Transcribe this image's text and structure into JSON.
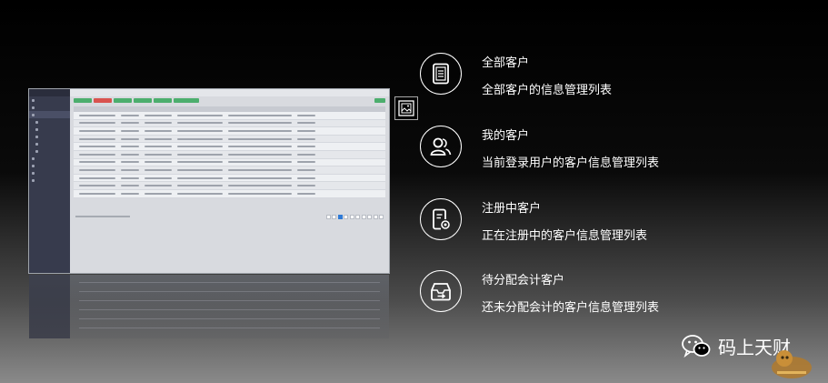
{
  "features": [
    {
      "title": "全部客户",
      "desc": "全部客户的信息管理列表",
      "icon": "document-list-icon"
    },
    {
      "title": "我的客户",
      "desc": "当前登录用户的客户信息管理列表",
      "icon": "users-icon"
    },
    {
      "title": "注册中客户",
      "desc": "正在注册中的客户信息管理列表",
      "icon": "document-gear-icon"
    },
    {
      "title": "待分配会计客户",
      "desc": "还未分配会计的客户信息管理列表",
      "icon": "tray-arrow-icon"
    }
  ],
  "brand": {
    "name": "码上天财",
    "icon": "wechat-icon"
  },
  "colors": {
    "background": "#000000",
    "accent_green": "#4cae6d",
    "accent_red": "#d9534f",
    "sidebar": "#373b4d"
  }
}
